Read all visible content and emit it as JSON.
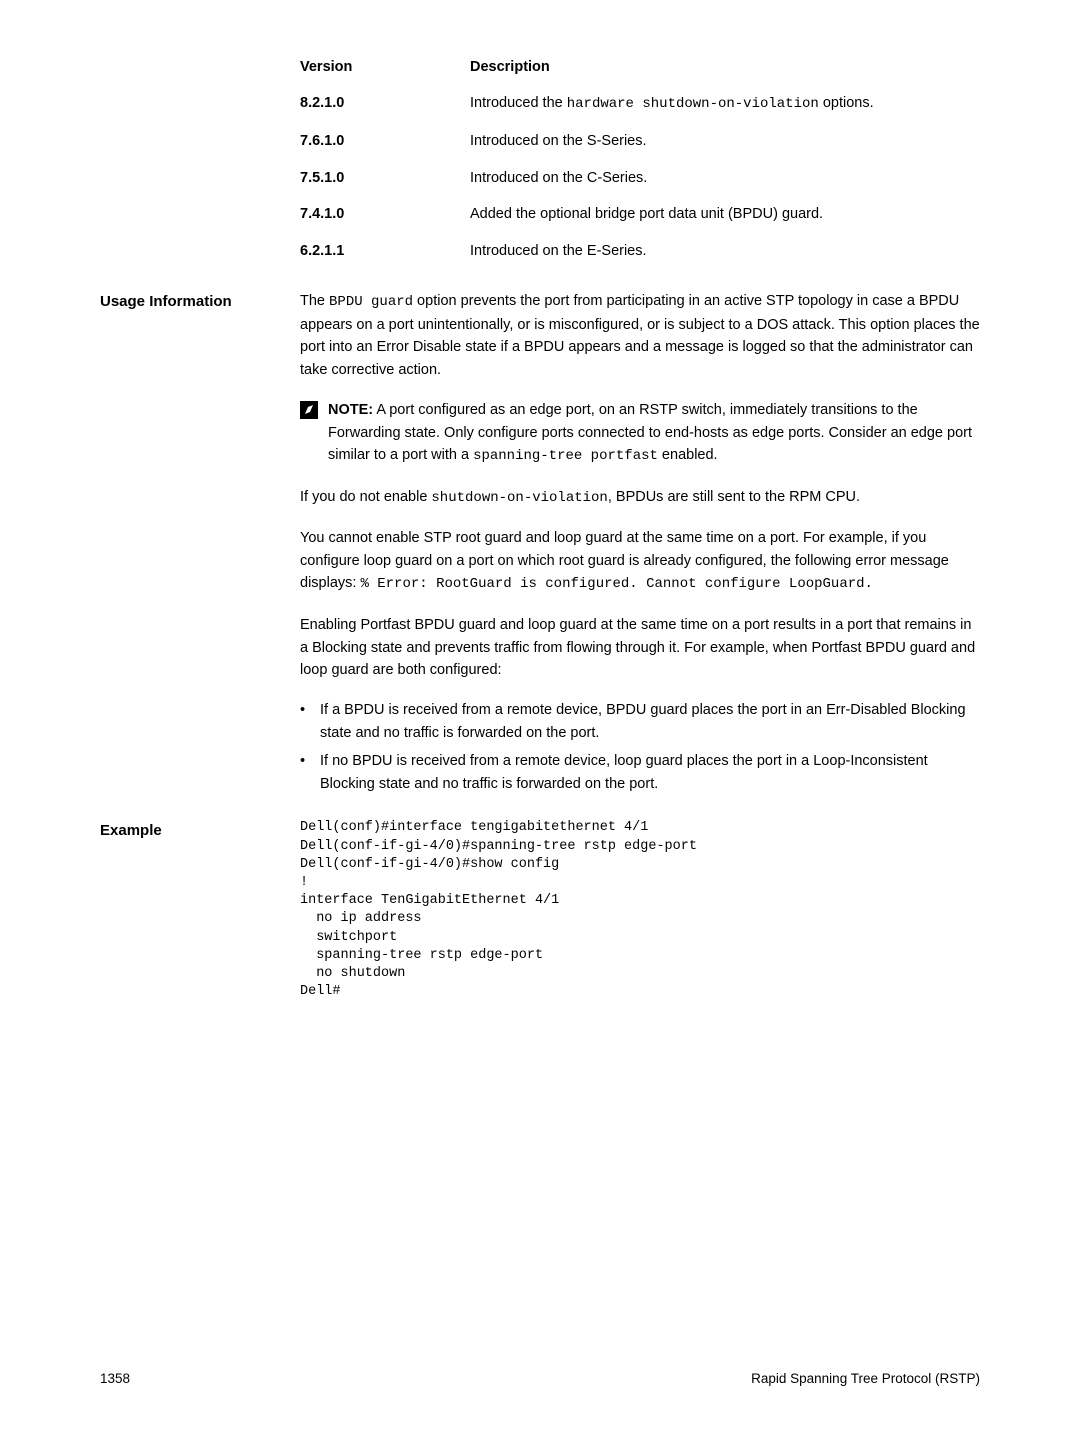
{
  "version_table": {
    "headers": {
      "col1": "Version",
      "col2": "Description"
    },
    "rows": [
      {
        "ver": "8.2.1.0",
        "desc_pre": "Introduced the ",
        "code": "hardware shutdown-on-violation",
        "desc_post": " options."
      },
      {
        "ver": "7.6.1.0",
        "desc": "Introduced on the S-Series."
      },
      {
        "ver": "7.5.1.0",
        "desc": "Introduced on the C-Series."
      },
      {
        "ver": "7.4.1.0",
        "desc": "Added the optional bridge port data unit (BPDU) guard."
      },
      {
        "ver": "6.2.1.1",
        "desc": "Introduced on the E-Series."
      }
    ]
  },
  "usage": {
    "label": "Usage Information",
    "para1_pre": "The ",
    "para1_code": "BPDU guard",
    "para1_post": " option prevents the port from participating in an active STP topology in case a BPDU appears on a port unintentionally, or is misconfigured, or is subject to a DOS attack. This option places the port into an Error Disable state if a BPDU appears and a message is logged so that the administrator can take corrective action.",
    "note_label": "NOTE:",
    "note_text_1": " A port configured as an edge port, on an RSTP switch, immediately transitions to the Forwarding state. Only configure ports connected to end-hosts as edge ports. Consider an edge port similar to a port with a ",
    "note_code": "spanning-tree portfast",
    "note_text_2": " enabled.",
    "para2_pre": "If you do not enable ",
    "para2_code": "shutdown-on-violation",
    "para2_post": ", BPDUs are still sent to the RPM CPU.",
    "para3_1": "You cannot enable STP root guard and loop guard at the same time on a port. For example, if you configure loop guard on a port on which root guard is already configured, the following error message displays: ",
    "para3_code": "% Error: RootGuard is configured. Cannot configure LoopGuard.",
    "para4": "Enabling Portfast BPDU guard and loop guard at the same time on a port results in a port that remains in a Blocking state and prevents traffic from flowing through it. For example, when Portfast BPDU guard and loop guard are both configured:",
    "bullets": [
      "If a BPDU is received from a remote device, BPDU guard places the port in an Err-Disabled Blocking state and no traffic is forwarded on the port.",
      "If no BPDU is received from a remote device, loop guard places the port in a Loop-Inconsistent Blocking state and no traffic is forwarded on the port."
    ]
  },
  "example": {
    "label": "Example",
    "code": "Dell(conf)#interface tengigabitethernet 4/1\nDell(conf-if-gi-4/0)#spanning-tree rstp edge-port\nDell(conf-if-gi-4/0)#show config\n!\ninterface TenGigabitEthernet 4/1\n  no ip address\n  switchport\n  spanning-tree rstp edge-port\n  no shutdown\nDell#"
  },
  "footer": {
    "page": "1358",
    "title": "Rapid Spanning Tree Protocol (RSTP)"
  }
}
